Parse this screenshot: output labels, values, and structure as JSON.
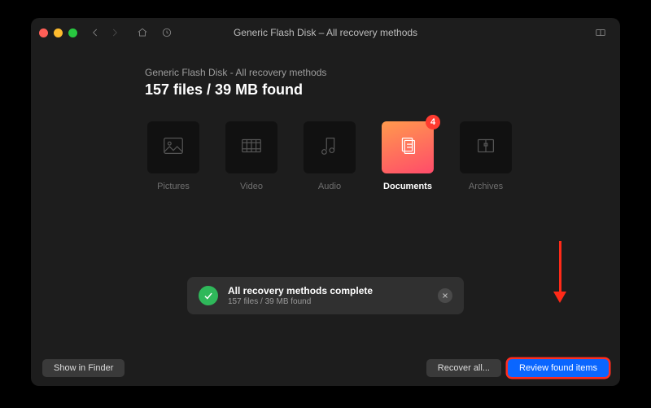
{
  "title": "Generic Flash Disk – All recovery methods",
  "breadcrumb": "Generic Flash Disk - All recovery methods",
  "summary": "157 files / 39 MB found",
  "categories": [
    {
      "key": "pictures",
      "label": "Pictures",
      "active": false
    },
    {
      "key": "video",
      "label": "Video",
      "active": false
    },
    {
      "key": "audio",
      "label": "Audio",
      "active": false
    },
    {
      "key": "documents",
      "label": "Documents",
      "active": true,
      "badge": "4"
    },
    {
      "key": "archives",
      "label": "Archives",
      "active": false
    }
  ],
  "toast": {
    "title": "All recovery methods complete",
    "subtitle": "157 files / 39 MB found"
  },
  "footer": {
    "show_in_finder": "Show in Finder",
    "recover_all": "Recover all...",
    "review": "Review found items"
  }
}
